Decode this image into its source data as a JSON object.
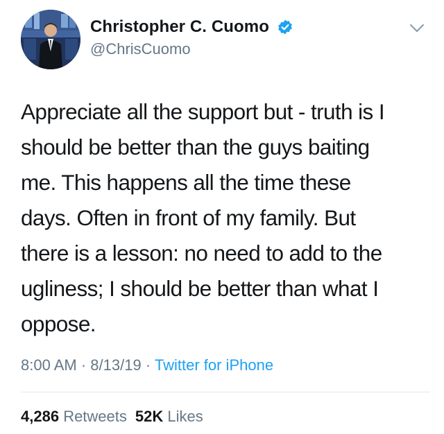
{
  "author": {
    "display_name": "Christopher C. Cuomo",
    "handle": "@ChrisCuomo",
    "verified": true,
    "avatar_icon": "avatar-photo"
  },
  "tweet": {
    "text": "Appreciate all the support but - truth is I\nshould be better than the guys baiting\nme. This happens all the time these\ndays. Often in front of my family. But\nthere is a lesson: no need to add to the\nugliness; I should be better than what I\noppose.",
    "time": "8:00 AM",
    "date": "8/13/19",
    "separator": "·",
    "source": "Twitter for iPhone"
  },
  "stats": {
    "retweets_count": "4,286",
    "retweets_label": "Retweets",
    "likes_count": "52K",
    "likes_label": "Likes"
  },
  "colors": {
    "verified_badge": "#1da1f2",
    "link": "#1da1f2",
    "secondary_text": "#657786"
  }
}
